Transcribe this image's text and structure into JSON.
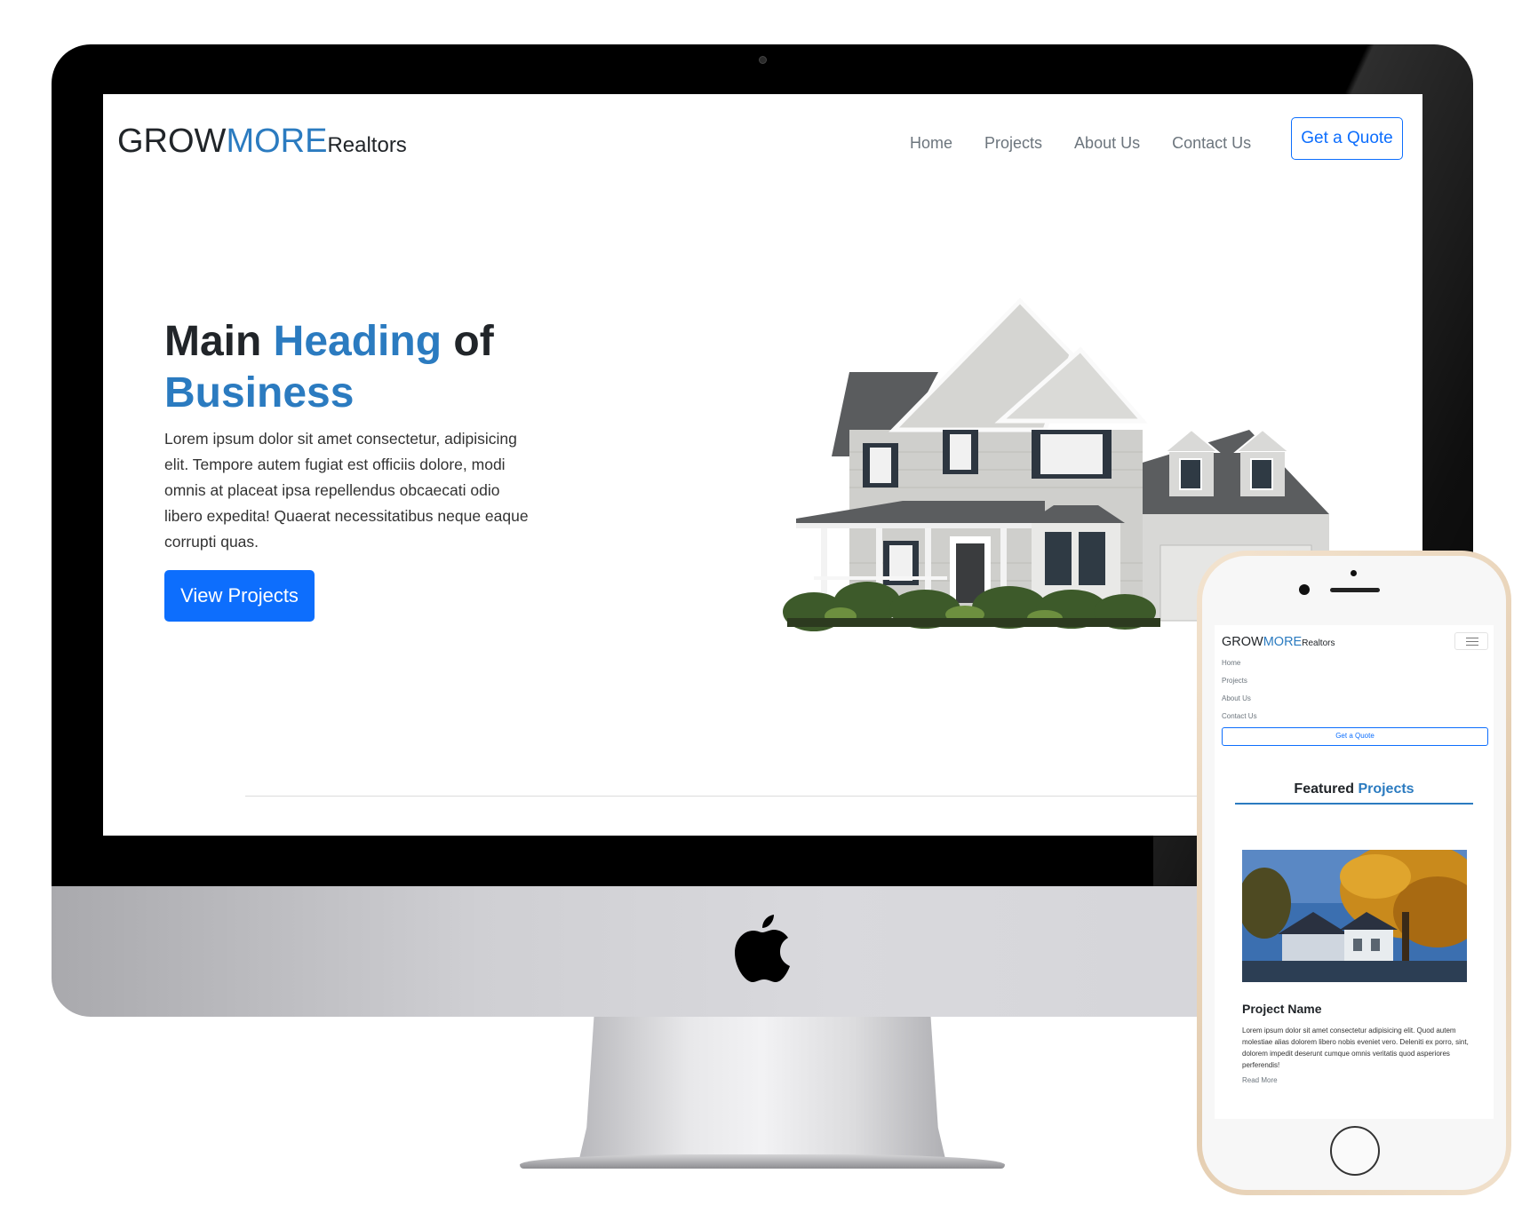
{
  "desktop": {
    "brand": {
      "part1": "GROW",
      "part2": "MORE",
      "part3": "Realtors"
    },
    "nav": [
      "Home",
      "Projects",
      "About Us",
      "Contact Us"
    ],
    "quote_button": "Get a Quote",
    "hero": {
      "title_part1": "Main ",
      "title_accent1": "Heading",
      "title_part2": " of",
      "title_accent2": "Business",
      "text": "Lorem ipsum dolor sit amet consectetur, adipisicing elit. Tempore autem fugiat est officiis dolore, modi omnis at placeat ipsa repellendus obcaecati odio libero expedita! Quaerat necessitatibus neque eaque corrupti quas.",
      "button": "View Projects"
    }
  },
  "mobile": {
    "brand": {
      "part1": "GROW",
      "part2": "MORE",
      "part3": "Realtors"
    },
    "nav": [
      "Home",
      "Projects",
      "About Us",
      "Contact Us"
    ],
    "quote_button": "Get a Quote",
    "featured": {
      "part1": "Featured ",
      "accent": "Projects"
    },
    "project": {
      "name": "Project Name",
      "text": "Lorem ipsum dolor sit amet consectetur adipisicing elit. Quod autem molestiae alias dolorem libero nobis eveniet vero. Deleniti ex porro, sint, dolorem impedit deserunt cumque omnis veritatis quod asperiores perferendis!",
      "read_more": "Read More"
    }
  },
  "colors": {
    "brand_accent": "#2b7bc0",
    "primary": "#0d6efd",
    "nav_text": "#6c757d"
  }
}
